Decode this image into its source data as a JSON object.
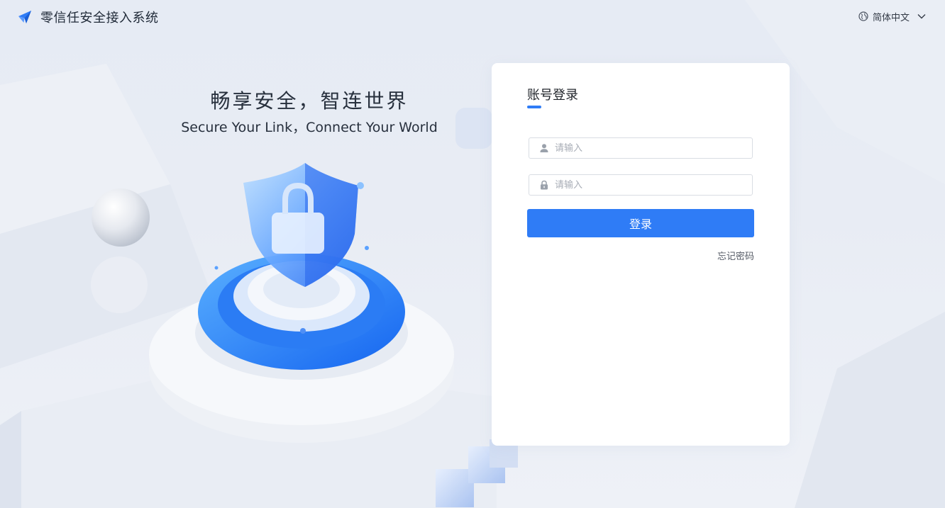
{
  "app": {
    "title": "零信任安全接入系统",
    "brand_icon": "paper-plane-icon"
  },
  "language": {
    "icon": "globe-icon",
    "selected": "简体中文",
    "chevron_icon": "chevron-down-icon"
  },
  "hero": {
    "title": "畅享安全，智连世界",
    "subtitle": "Secure Your Link，Connect Your World",
    "illustration": "shield-lock-icon"
  },
  "login": {
    "tab_label": "账号登录",
    "username": {
      "placeholder": "请输入",
      "value": "",
      "icon": "user-icon"
    },
    "password": {
      "placeholder": "请输入",
      "value": "",
      "icon": "lock-icon"
    },
    "submit_label": "登录",
    "forgot_label": "忘记密码"
  },
  "colors": {
    "accent": "#2f7cf6",
    "background": "#e8ecf4",
    "card": "#ffffff"
  }
}
